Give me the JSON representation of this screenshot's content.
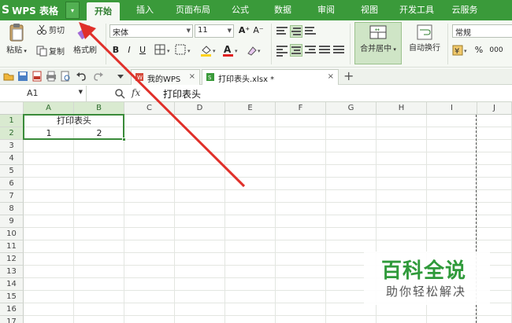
{
  "app": {
    "title": "WPS 表格",
    "dropdown_arrow": "▾"
  },
  "menu": {
    "tabs": [
      "开始",
      "插入",
      "页面布局",
      "公式",
      "数据",
      "审阅",
      "视图",
      "开发工具",
      "云服务"
    ],
    "active": "开始"
  },
  "ribbon": {
    "paste": "粘贴",
    "cut": "剪切",
    "copy": "复制",
    "format_painter": "格式刷",
    "font_name": "宋体",
    "font_size": "11",
    "bold": "B",
    "italic": "I",
    "underline": "U",
    "grow_font": "A⁺",
    "shrink_font": "A⁻",
    "merge_center": "合并居中",
    "wrap_text": "自动换行",
    "number_format": "常规",
    "percent": "%",
    "thousands": "000"
  },
  "doc_tabs": [
    {
      "label": "我的WPS",
      "close": "×"
    },
    {
      "label": "打印表头.xlsx *",
      "close": "×"
    }
  ],
  "new_tab": "+",
  "formula_bar": {
    "name_box": "A1",
    "fx": "fx",
    "content": "打印表头"
  },
  "grid": {
    "columns": [
      "A",
      "B",
      "C",
      "D",
      "E",
      "F",
      "G",
      "H",
      "I",
      "J"
    ],
    "rows": [
      "1",
      "2",
      "3",
      "4",
      "5",
      "6",
      "7",
      "8",
      "9",
      "10",
      "11",
      "12",
      "13",
      "14",
      "15",
      "16",
      "17"
    ],
    "cells": {
      "A1": "打印表头",
      "A2": "1",
      "B2": "2"
    }
  },
  "watermark": {
    "title": "百科全说",
    "subtitle": "助你轻松解决"
  },
  "colors": {
    "accent": "#3a9a3a",
    "selection": "#3a8b3a",
    "arrow": "#e0302a",
    "watermark": "#2f9a3a"
  }
}
